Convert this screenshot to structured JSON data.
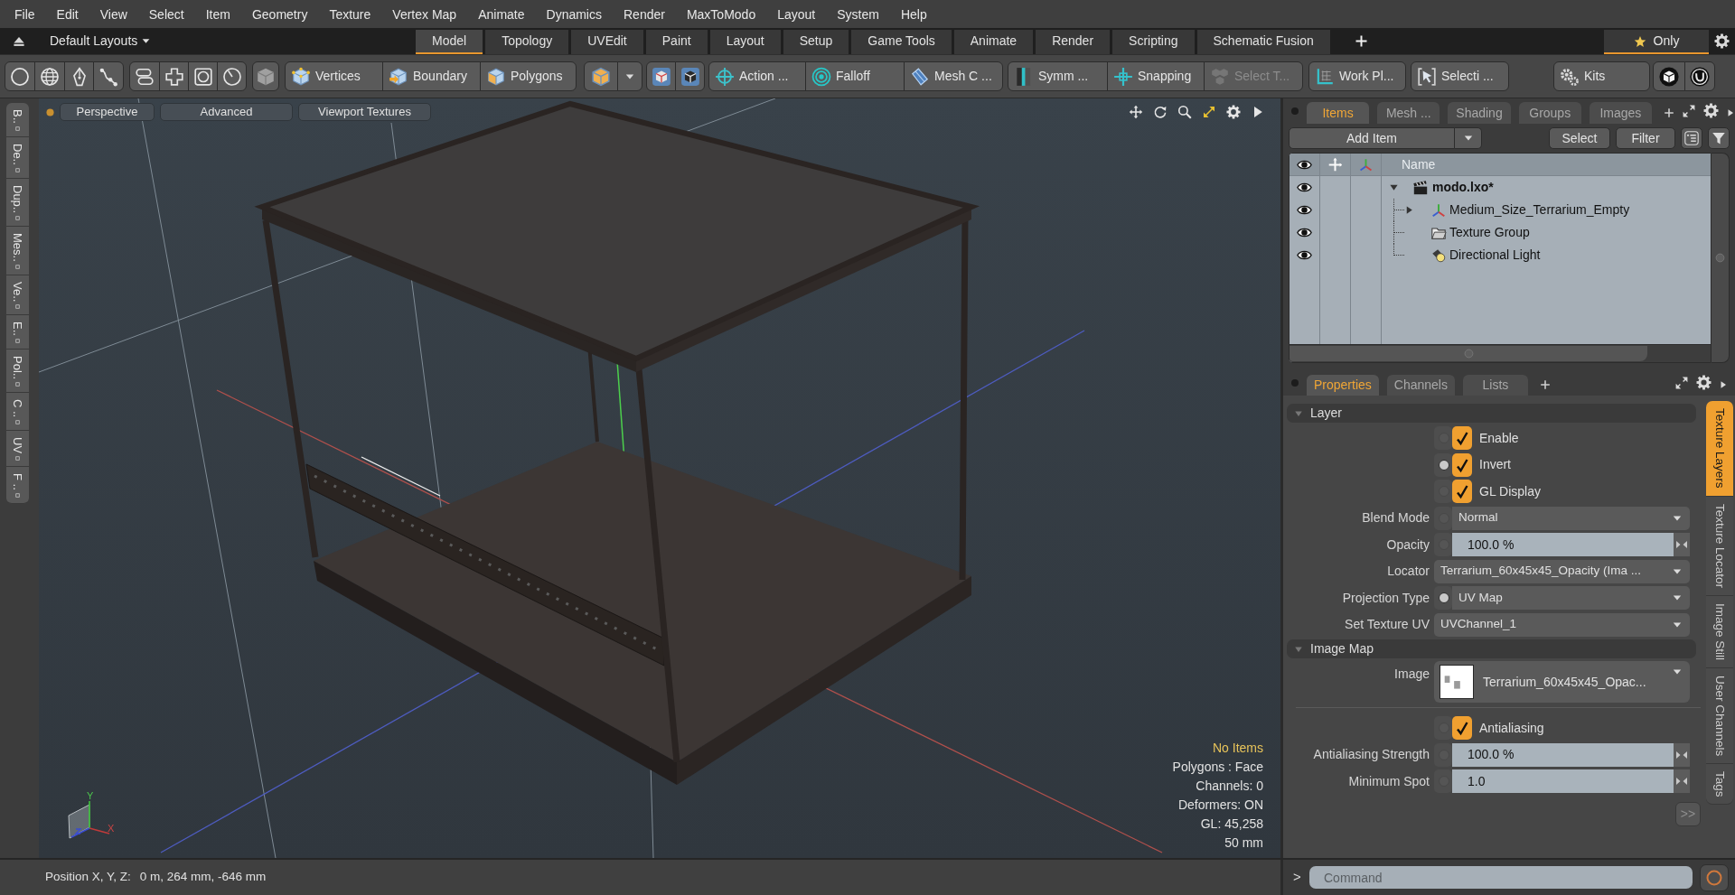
{
  "menu": [
    "File",
    "Edit",
    "View",
    "Select",
    "Item",
    "Geometry",
    "Texture",
    "Vertex Map",
    "Animate",
    "Dynamics",
    "Render",
    "MaxToModo",
    "Layout",
    "System",
    "Help"
  ],
  "layout_bar": {
    "preset": "Default Layouts",
    "tabs": [
      {
        "label": "Model",
        "selected": true
      },
      {
        "label": "Topology",
        "selected": false
      },
      {
        "label": "UVEdit",
        "selected": false
      },
      {
        "label": "Paint",
        "selected": false
      },
      {
        "label": "Layout",
        "selected": false
      },
      {
        "label": "Setup",
        "selected": false
      },
      {
        "label": "Game Tools",
        "selected": false
      },
      {
        "label": "Animate",
        "selected": false
      },
      {
        "label": "Render",
        "selected": false
      },
      {
        "label": "Scripting",
        "selected": false
      },
      {
        "label": "Schematic Fusion",
        "selected": false
      }
    ],
    "only": {
      "label": "Only",
      "on": true
    }
  },
  "toolbar": {
    "buttons": [
      {
        "label": "Vertices",
        "disabled": false
      },
      {
        "label": "Boundary",
        "disabled": false
      },
      {
        "label": "Polygons",
        "disabled": false
      },
      {
        "label": "Action ...",
        "disabled": false
      },
      {
        "label": "Falloff",
        "disabled": false
      },
      {
        "label": "Mesh C ...",
        "disabled": false
      },
      {
        "label": "Symm ...",
        "disabled": false
      },
      {
        "label": "Snapping",
        "disabled": false
      },
      {
        "label": "Select T...",
        "disabled": true
      },
      {
        "label": "Work Pl...",
        "disabled": false
      },
      {
        "label": "Selecti ...",
        "disabled": false
      },
      {
        "label": "Kits",
        "disabled": false
      }
    ]
  },
  "left_tabs": [
    "B..",
    "De..",
    "Dup..",
    "Mes..",
    "Ve..",
    "E..",
    "Pol..",
    "C ..",
    "UV",
    "F .."
  ],
  "viewport": {
    "buttons": [
      "Perspective",
      "Advanced",
      "Viewport Textures"
    ],
    "selection_status": "No Items",
    "stats": [
      "Polygons : Face",
      "Channels: 0",
      "Deformers: ON",
      "GL: 45,258",
      "50 mm"
    ],
    "gizmo_labels": [
      "Y",
      "X"
    ]
  },
  "items_panel": {
    "tabs": [
      {
        "label": "Items",
        "selected": true
      },
      {
        "label": "Mesh ...",
        "selected": false
      },
      {
        "label": "Shading",
        "selected": false
      },
      {
        "label": "Groups",
        "selected": false
      },
      {
        "label": "Images",
        "selected": false
      }
    ],
    "add_button": "Add Item",
    "buttons": [
      "Select",
      "Filter"
    ],
    "name_column": "Name",
    "tree": [
      {
        "name": "modo.lxo*",
        "kind": "scene",
        "visible": true,
        "expanded": true,
        "children": [
          {
            "name": "Medium_Size_Terrarium_Empty",
            "kind": "locator",
            "visible": true,
            "expanded": false
          },
          {
            "name": "Texture Group",
            "kind": "group",
            "visible": true
          },
          {
            "name": "Directional Light",
            "kind": "light",
            "visible": true
          }
        ]
      }
    ]
  },
  "properties_panel": {
    "tabs": [
      {
        "label": "Properties",
        "selected": true
      },
      {
        "label": "Channels",
        "selected": false
      },
      {
        "label": "Lists",
        "selected": false
      }
    ],
    "sections": [
      {
        "title": "Layer",
        "expanded": true,
        "rows": [
          {
            "kind": "checkbox",
            "label": "Enable",
            "checked": true,
            "dot_lit": false
          },
          {
            "kind": "checkbox",
            "label": "Invert",
            "checked": true,
            "dot_lit": true
          },
          {
            "kind": "checkbox",
            "label": "GL Display",
            "checked": true,
            "dot_lit": false
          },
          {
            "kind": "dropdown",
            "label": "Blend Mode",
            "value": "Normal",
            "dot_lit": false
          },
          {
            "kind": "number",
            "label": "Opacity",
            "value": "100.0 %",
            "dot_lit": false
          },
          {
            "kind": "dropdown",
            "label": "Locator",
            "value": "Terrarium_60x45x45_Opacity (Ima ..."
          },
          {
            "kind": "dropdown",
            "label": "Projection Type",
            "value": "UV Map",
            "dot_lit": true
          },
          {
            "kind": "dropdown",
            "label": "Set Texture UV",
            "value": "UVChannel_1"
          }
        ]
      },
      {
        "title": "Image Map",
        "expanded": true,
        "rows": [
          {
            "kind": "image",
            "label": "Image",
            "value": "Terrarium_60x45x45_Opac..."
          },
          {
            "kind": "checkbox",
            "label": "Antialiasing",
            "checked": true,
            "dot_lit": false
          },
          {
            "kind": "number",
            "label": "Antialiasing Strength",
            "value": "100.0 %",
            "dot_lit": false
          },
          {
            "kind": "number",
            "label": "Minimum Spot",
            "value": "1.0",
            "dot_lit": false
          }
        ]
      }
    ],
    "more_button": ">>",
    "side_tabs": [
      {
        "label": "Texture Layers",
        "selected": true
      },
      {
        "label": "Texture Locator",
        "selected": false
      },
      {
        "label": "Image Still",
        "selected": false
      },
      {
        "label": "User Channels",
        "selected": false
      },
      {
        "label": "Tags",
        "selected": false
      }
    ]
  },
  "status_bar": {
    "label": "Position X, Y, Z:",
    "value": "0 m, 264 mm, -646 mm"
  },
  "command_bar": {
    "prompt": ">",
    "placeholder": "Command"
  }
}
